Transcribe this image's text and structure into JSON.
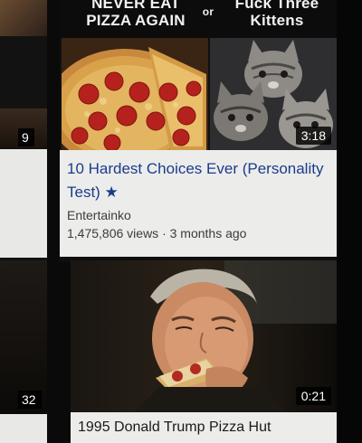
{
  "prev_items": {
    "badge_top": "9",
    "badge_bottom": "32"
  },
  "video1": {
    "thumbnail": {
      "caption_left": "NEVER EAT PIZZA AGAIN",
      "caption_or": "or",
      "caption_right": "Fuck Three Kittens",
      "left_image": "pizza",
      "right_image": "three-kittens"
    },
    "duration": "3:18",
    "title": "10 Hardest Choices Ever (Personality Test) ★",
    "channel": "Entertainko",
    "stats": "1,475,806 views · 3 months ago"
  },
  "video2": {
    "thumbnail": {
      "image": "man-eating-pizza"
    },
    "duration": "0:21",
    "title": "1995 Donald Trump Pizza Hut"
  },
  "colors": {
    "title_link": "#1a3c8c",
    "card_background": "#ececea",
    "duration_badge": "#000000"
  }
}
